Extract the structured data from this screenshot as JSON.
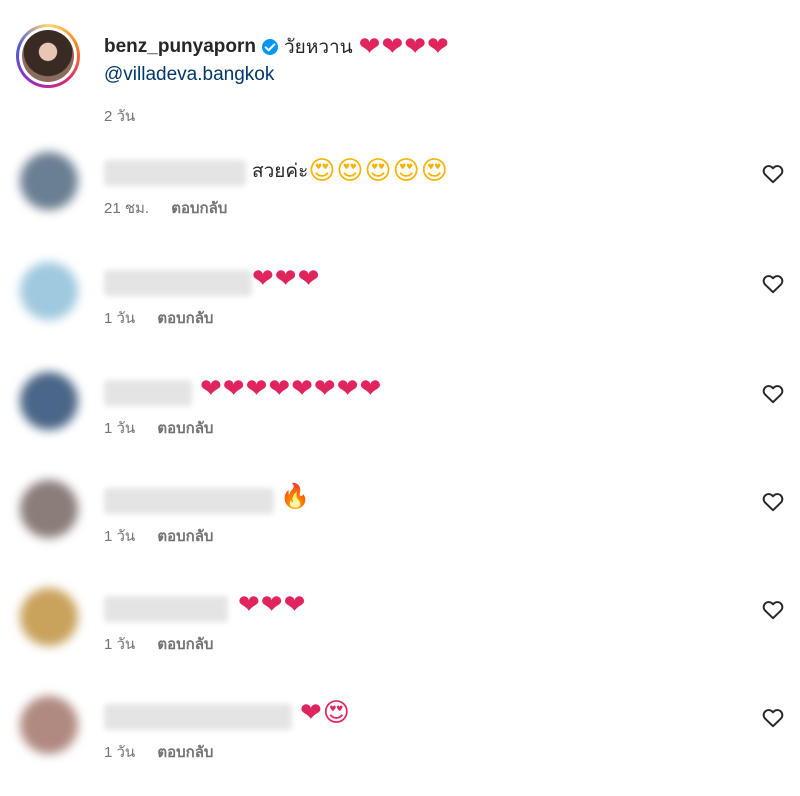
{
  "post": {
    "username": "benz_punyaporn",
    "caption": "วัยหวาน",
    "caption_emojis": "❤❤❤❤",
    "mention": "@villadeva.bangkok",
    "time": "2 วัน"
  },
  "labels": {
    "reply": "ตอบกลับ"
  },
  "icons": {
    "verified": "verified-badge-icon",
    "like": "heart-outline-icon"
  },
  "comments": [
    {
      "text": "สวยค่ะ",
      "emojis": "😍😍😍😍😍",
      "emoji_kind": "face",
      "time": "21 ชม.",
      "avatar_color": "#6b7f93"
    },
    {
      "text": "",
      "emojis": "❤❤❤",
      "emoji_kind": "heart",
      "time": "1 วัน",
      "avatar_color": "#9fc9df"
    },
    {
      "text": "",
      "emojis": "❤❤❤❤❤❤❤❤",
      "emoji_kind": "heart",
      "time": "1 วัน",
      "avatar_color": "#4a6688"
    },
    {
      "text": "",
      "emojis": "🔥",
      "emoji_kind": "fire",
      "time": "1 วัน",
      "avatar_color": "#8a7d7a"
    },
    {
      "text": "",
      "emojis": "❤❤❤",
      "emoji_kind": "heart",
      "time": "1 วัน",
      "avatar_color": "#c9a25c"
    },
    {
      "text": "",
      "emojis": "❤😍",
      "emoji_kind": "mixed",
      "time": "1 วัน",
      "avatar_color": "#b08a80"
    }
  ]
}
